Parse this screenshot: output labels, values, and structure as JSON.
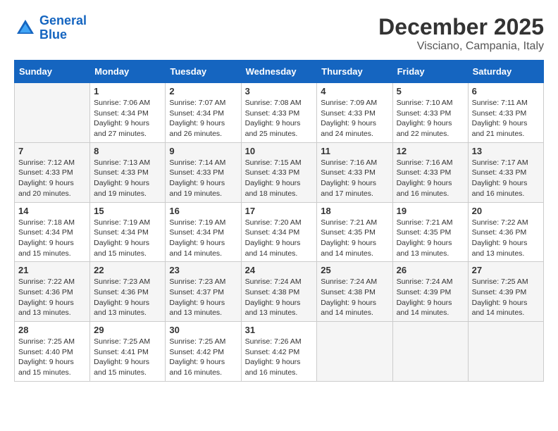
{
  "header": {
    "logo_line1": "General",
    "logo_line2": "Blue",
    "month": "December 2025",
    "location": "Visciano, Campania, Italy"
  },
  "weekdays": [
    "Sunday",
    "Monday",
    "Tuesday",
    "Wednesday",
    "Thursday",
    "Friday",
    "Saturday"
  ],
  "weeks": [
    [
      {
        "num": "",
        "info": ""
      },
      {
        "num": "1",
        "info": "Sunrise: 7:06 AM\nSunset: 4:34 PM\nDaylight: 9 hours\nand 27 minutes."
      },
      {
        "num": "2",
        "info": "Sunrise: 7:07 AM\nSunset: 4:34 PM\nDaylight: 9 hours\nand 26 minutes."
      },
      {
        "num": "3",
        "info": "Sunrise: 7:08 AM\nSunset: 4:33 PM\nDaylight: 9 hours\nand 25 minutes."
      },
      {
        "num": "4",
        "info": "Sunrise: 7:09 AM\nSunset: 4:33 PM\nDaylight: 9 hours\nand 24 minutes."
      },
      {
        "num": "5",
        "info": "Sunrise: 7:10 AM\nSunset: 4:33 PM\nDaylight: 9 hours\nand 22 minutes."
      },
      {
        "num": "6",
        "info": "Sunrise: 7:11 AM\nSunset: 4:33 PM\nDaylight: 9 hours\nand 21 minutes."
      }
    ],
    [
      {
        "num": "7",
        "info": "Sunrise: 7:12 AM\nSunset: 4:33 PM\nDaylight: 9 hours\nand 20 minutes."
      },
      {
        "num": "8",
        "info": "Sunrise: 7:13 AM\nSunset: 4:33 PM\nDaylight: 9 hours\nand 19 minutes."
      },
      {
        "num": "9",
        "info": "Sunrise: 7:14 AM\nSunset: 4:33 PM\nDaylight: 9 hours\nand 19 minutes."
      },
      {
        "num": "10",
        "info": "Sunrise: 7:15 AM\nSunset: 4:33 PM\nDaylight: 9 hours\nand 18 minutes."
      },
      {
        "num": "11",
        "info": "Sunrise: 7:16 AM\nSunset: 4:33 PM\nDaylight: 9 hours\nand 17 minutes."
      },
      {
        "num": "12",
        "info": "Sunrise: 7:16 AM\nSunset: 4:33 PM\nDaylight: 9 hours\nand 16 minutes."
      },
      {
        "num": "13",
        "info": "Sunrise: 7:17 AM\nSunset: 4:33 PM\nDaylight: 9 hours\nand 16 minutes."
      }
    ],
    [
      {
        "num": "14",
        "info": "Sunrise: 7:18 AM\nSunset: 4:34 PM\nDaylight: 9 hours\nand 15 minutes."
      },
      {
        "num": "15",
        "info": "Sunrise: 7:19 AM\nSunset: 4:34 PM\nDaylight: 9 hours\nand 15 minutes."
      },
      {
        "num": "16",
        "info": "Sunrise: 7:19 AM\nSunset: 4:34 PM\nDaylight: 9 hours\nand 14 minutes."
      },
      {
        "num": "17",
        "info": "Sunrise: 7:20 AM\nSunset: 4:34 PM\nDaylight: 9 hours\nand 14 minutes."
      },
      {
        "num": "18",
        "info": "Sunrise: 7:21 AM\nSunset: 4:35 PM\nDaylight: 9 hours\nand 14 minutes."
      },
      {
        "num": "19",
        "info": "Sunrise: 7:21 AM\nSunset: 4:35 PM\nDaylight: 9 hours\nand 13 minutes."
      },
      {
        "num": "20",
        "info": "Sunrise: 7:22 AM\nSunset: 4:36 PM\nDaylight: 9 hours\nand 13 minutes."
      }
    ],
    [
      {
        "num": "21",
        "info": "Sunrise: 7:22 AM\nSunset: 4:36 PM\nDaylight: 9 hours\nand 13 minutes."
      },
      {
        "num": "22",
        "info": "Sunrise: 7:23 AM\nSunset: 4:36 PM\nDaylight: 9 hours\nand 13 minutes."
      },
      {
        "num": "23",
        "info": "Sunrise: 7:23 AM\nSunset: 4:37 PM\nDaylight: 9 hours\nand 13 minutes."
      },
      {
        "num": "24",
        "info": "Sunrise: 7:24 AM\nSunset: 4:38 PM\nDaylight: 9 hours\nand 13 minutes."
      },
      {
        "num": "25",
        "info": "Sunrise: 7:24 AM\nSunset: 4:38 PM\nDaylight: 9 hours\nand 14 minutes."
      },
      {
        "num": "26",
        "info": "Sunrise: 7:24 AM\nSunset: 4:39 PM\nDaylight: 9 hours\nand 14 minutes."
      },
      {
        "num": "27",
        "info": "Sunrise: 7:25 AM\nSunset: 4:39 PM\nDaylight: 9 hours\nand 14 minutes."
      }
    ],
    [
      {
        "num": "28",
        "info": "Sunrise: 7:25 AM\nSunset: 4:40 PM\nDaylight: 9 hours\nand 15 minutes."
      },
      {
        "num": "29",
        "info": "Sunrise: 7:25 AM\nSunset: 4:41 PM\nDaylight: 9 hours\nand 15 minutes."
      },
      {
        "num": "30",
        "info": "Sunrise: 7:25 AM\nSunset: 4:42 PM\nDaylight: 9 hours\nand 16 minutes."
      },
      {
        "num": "31",
        "info": "Sunrise: 7:26 AM\nSunset: 4:42 PM\nDaylight: 9 hours\nand 16 minutes."
      },
      {
        "num": "",
        "info": ""
      },
      {
        "num": "",
        "info": ""
      },
      {
        "num": "",
        "info": ""
      }
    ]
  ]
}
